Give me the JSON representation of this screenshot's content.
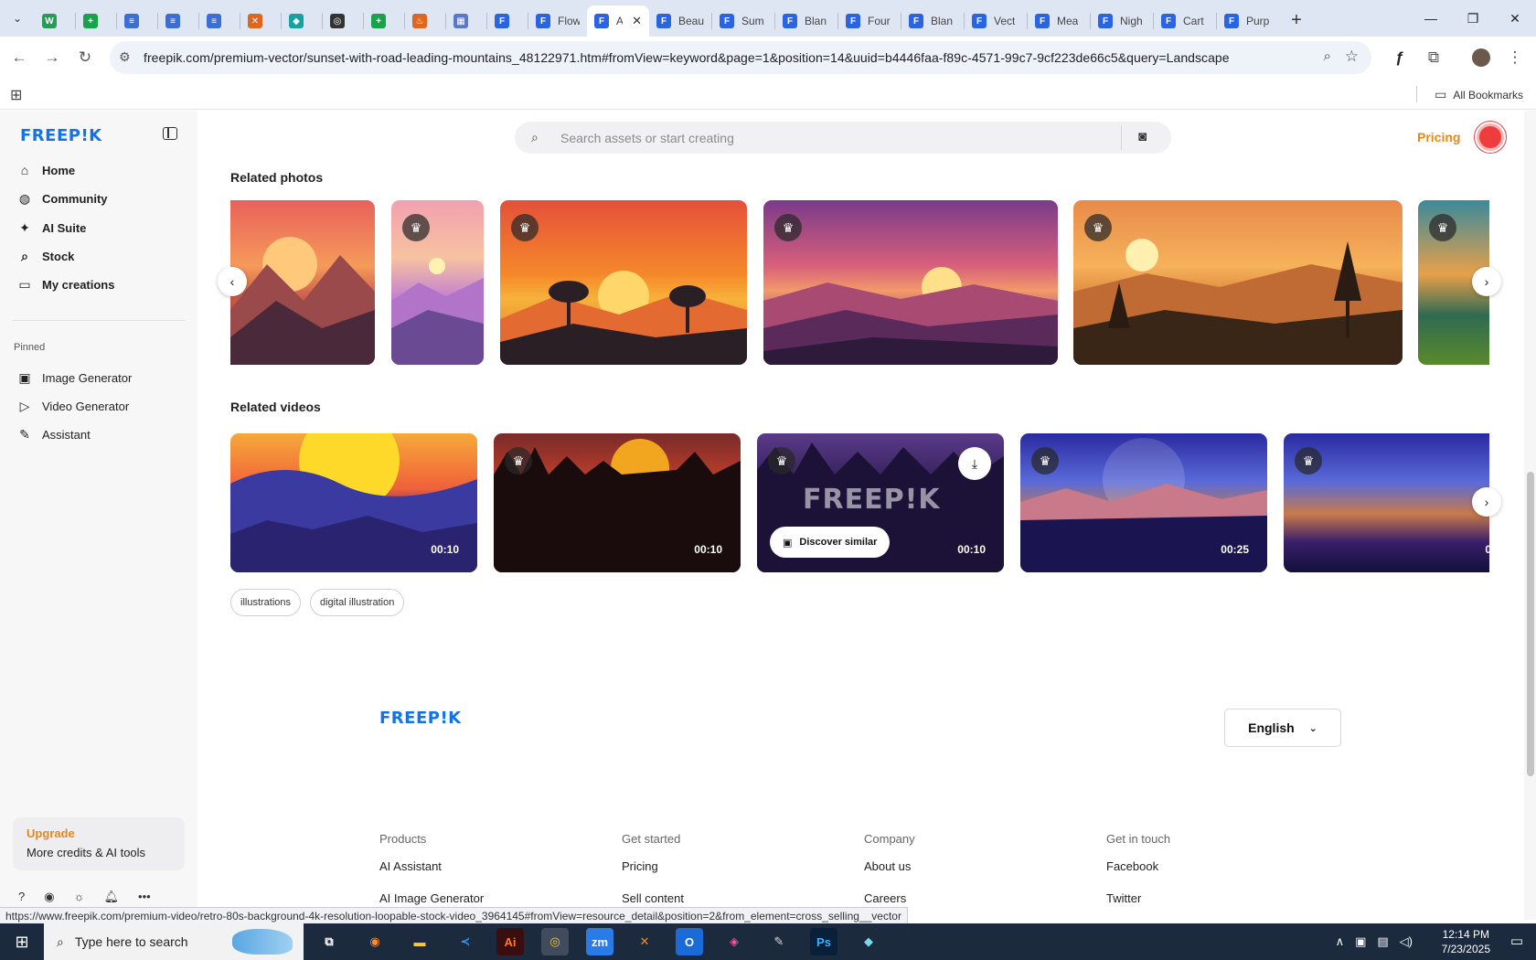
{
  "browser": {
    "tabs": [
      {
        "title": "",
        "color": "#2b9a56",
        "glyph": "W"
      },
      {
        "title": "",
        "color": "#16a34a",
        "glyph": "+"
      },
      {
        "title": "",
        "color": "#3b6fd8",
        "glyph": "≡"
      },
      {
        "title": "",
        "color": "#3b6fd8",
        "glyph": "≡"
      },
      {
        "title": "",
        "color": "#3b6fd8",
        "glyph": "≡"
      },
      {
        "title": "",
        "color": "#e0651e",
        "glyph": "✕"
      },
      {
        "title": "",
        "color": "#17a2a2",
        "glyph": "◆"
      },
      {
        "title": "",
        "color": "#333333",
        "glyph": "◎"
      },
      {
        "title": "",
        "color": "#16a34a",
        "glyph": "+"
      },
      {
        "title": "",
        "color": "#e0651e",
        "glyph": "♨"
      },
      {
        "title": "",
        "color": "#5a78c8",
        "glyph": "▦"
      },
      {
        "title": "",
        "color": "#2a64e0",
        "glyph": "F"
      },
      {
        "title": "Flow",
        "color": "#2a64e0",
        "glyph": "F"
      },
      {
        "title": "A",
        "color": "#2a64e0",
        "glyph": "F",
        "active": true
      },
      {
        "title": "Beau",
        "color": "#2a64e0",
        "glyph": "F"
      },
      {
        "title": "Sum",
        "color": "#2a64e0",
        "glyph": "F"
      },
      {
        "title": "Blan",
        "color": "#2a64e0",
        "glyph": "F"
      },
      {
        "title": "Four",
        "color": "#2a64e0",
        "glyph": "F"
      },
      {
        "title": "Blan",
        "color": "#2a64e0",
        "glyph": "F"
      },
      {
        "title": "Vect",
        "color": "#2a64e0",
        "glyph": "F"
      },
      {
        "title": "Mea",
        "color": "#2a64e0",
        "glyph": "F"
      },
      {
        "title": "Nigh",
        "color": "#2a64e0",
        "glyph": "F"
      },
      {
        "title": "Cart",
        "color": "#2a64e0",
        "glyph": "F"
      },
      {
        "title": "Purp",
        "color": "#2a64e0",
        "glyph": "F"
      }
    ],
    "url": "freepik.com/premium-vector/sunset-with-road-leading-mountains_48122971.htm#fromView=keyword&page=1&position=14&uuid=b4446faa-f89c-4571-99c7-9cf223de66c5&query=Landscape",
    "all_bookmarks": "All Bookmarks",
    "status_url": "https://www.freepik.com/premium-video/retro-80s-background-4k-resolution-loopable-stock-video_3964145#fromView=resource_detail&position=2&from_element=cross_selling__vector"
  },
  "sidebar": {
    "logo": "FREEP!K",
    "nav": [
      {
        "label": "Home",
        "icon": "home-icon",
        "glyph": "⌂"
      },
      {
        "label": "Community",
        "icon": "globe-icon",
        "glyph": "◍"
      },
      {
        "label": "AI Suite",
        "icon": "sparkle-icon",
        "glyph": "✦"
      },
      {
        "label": "Stock",
        "icon": "search-icon",
        "glyph": "⌕"
      },
      {
        "label": "My creations",
        "icon": "folder-icon",
        "glyph": "▭"
      }
    ],
    "pinned_label": "Pinned",
    "pinned": [
      {
        "label": "Image Generator",
        "icon": "image-icon",
        "glyph": "▣"
      },
      {
        "label": "Video Generator",
        "icon": "video-icon",
        "glyph": "▷"
      },
      {
        "label": "Assistant",
        "icon": "assistant-icon",
        "glyph": "✎"
      }
    ],
    "upgrade_title": "Upgrade",
    "upgrade_sub": "More credits & AI tools"
  },
  "header": {
    "search_placeholder": "Search assets or start creating",
    "pricing": "Pricing"
  },
  "related_photos": {
    "title": "Related photos"
  },
  "related_videos": {
    "title": "Related videos",
    "items": [
      {
        "duration": "00:10"
      },
      {
        "duration": "00:10"
      },
      {
        "duration": "00:10",
        "discover": "Discover similar",
        "watermark": "FREEP!K"
      },
      {
        "duration": "00:25"
      },
      {
        "duration": "0"
      }
    ]
  },
  "tags": [
    "illustrations",
    "digital illustration"
  ],
  "footer": {
    "logo": "FREEP!K",
    "language": "English",
    "columns": [
      {
        "heading": "Products",
        "links": [
          "AI Assistant",
          "AI Image Generator"
        ]
      },
      {
        "heading": "Get started",
        "links": [
          "Pricing",
          "Sell content"
        ]
      },
      {
        "heading": "Company",
        "links": [
          "About us",
          "Careers"
        ]
      },
      {
        "heading": "Get in touch",
        "links": [
          "Facebook",
          "Twitter"
        ]
      }
    ]
  },
  "taskbar": {
    "search_placeholder": "Type here to search",
    "time": "12:14 PM",
    "date": "7/23/2025"
  }
}
